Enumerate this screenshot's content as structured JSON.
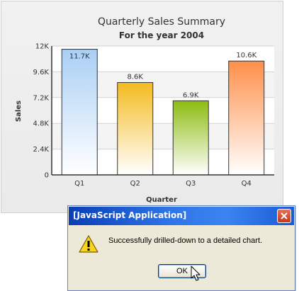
{
  "chart_data": {
    "type": "bar",
    "title": "Quarterly Sales Summary",
    "subtitle": "For the year 2004",
    "xlabel": "Quarter",
    "ylabel": "Sales",
    "categories": [
      "Q1",
      "Q2",
      "Q3",
      "Q4"
    ],
    "values": [
      11700,
      8600,
      6900,
      10600
    ],
    "value_labels": [
      "11.7K",
      "8.6K",
      "6.9K",
      "10.6K"
    ],
    "ylim": [
      0,
      12000
    ],
    "y_ticks": [
      0,
      2400,
      4800,
      7200,
      9600,
      12000
    ],
    "y_tick_labels": [
      "0",
      "2.4K",
      "4.8K",
      "7.2K",
      "9.6K",
      "12K"
    ],
    "grid": true,
    "bar_colors": [
      {
        "top": "#aacff5",
        "bottom": "#ffffff"
      },
      {
        "top": "#f4bb20",
        "bottom": "#ffffff"
      },
      {
        "top": "#8cbc10",
        "bottom": "#ffffff"
      },
      {
        "top": "#ff8f4a",
        "bottom": "#ffffff"
      }
    ]
  },
  "dialog": {
    "title": "[JavaScript Application]",
    "message": "Successfully drilled-down to a detailed chart.",
    "ok_label": "OK",
    "icon": "warning-icon",
    "title_color": "#2f74e8"
  }
}
